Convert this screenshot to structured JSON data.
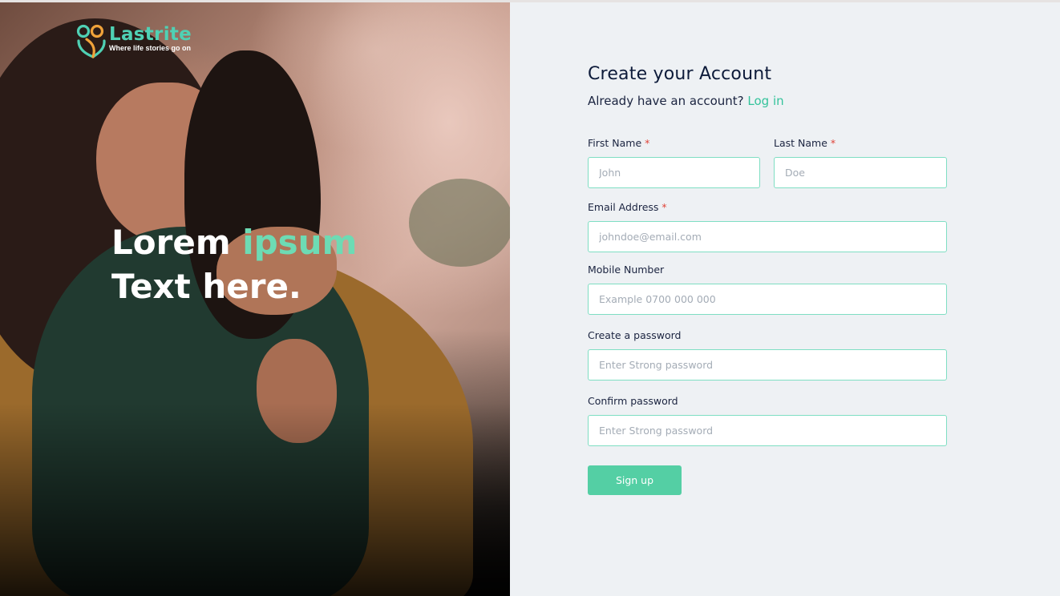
{
  "brand": {
    "name": "Lastrite",
    "tagline": "Where life stories go on",
    "accent_color": "#4fd1b4"
  },
  "hero": {
    "headline_word1": "Lorem",
    "headline_accent": "ipsum",
    "headline_line2": "Text here.",
    "accent_color": "#6ddbb4"
  },
  "form": {
    "title": "Create your Account",
    "login_prompt": "Already have an account?",
    "login_link": "Log in",
    "required_marker": "*",
    "fields": {
      "first_name": {
        "label": "First Name",
        "placeholder": "John",
        "value": ""
      },
      "last_name": {
        "label": "Last Name",
        "placeholder": "Doe",
        "value": ""
      },
      "email": {
        "label": "Email Address",
        "placeholder": "johndoe@email.com",
        "value": ""
      },
      "mobile": {
        "label": "Mobile Number",
        "placeholder": "Example 0700 000 000",
        "value": ""
      },
      "password": {
        "label": "Create a password",
        "placeholder": "Enter Strong password",
        "value": ""
      },
      "confirm_password": {
        "label": "Confirm password",
        "placeholder": "Enter Strong password",
        "value": ""
      }
    },
    "submit_label": "Sign up",
    "button_color": "#54cfa4",
    "input_border_color": "#7fdec3",
    "link_color": "#34c39b"
  }
}
